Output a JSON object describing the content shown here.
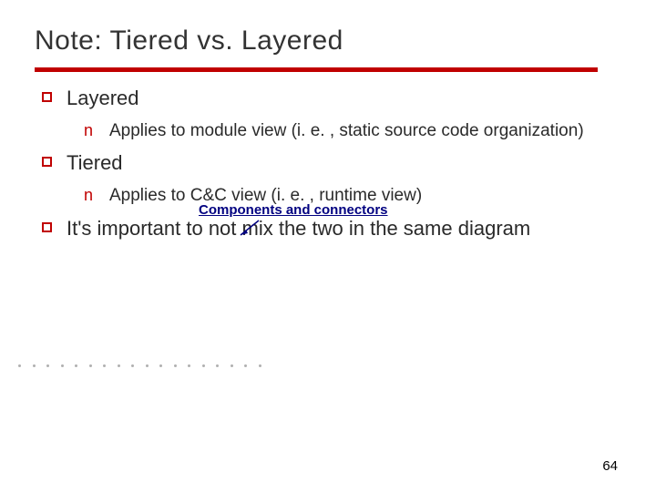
{
  "title": "Note: Tiered vs. Layered",
  "bullets": [
    {
      "heading": "Layered",
      "sub": "Applies to module view (i. e. , static source code organization)"
    },
    {
      "heading": "Tiered",
      "sub": "Applies to C&C view (i. e. , runtime view)"
    },
    {
      "heading": "It's important to not mix the two in the same diagram",
      "sub": null
    }
  ],
  "annotation": "Components and connectors",
  "page_number": "64"
}
